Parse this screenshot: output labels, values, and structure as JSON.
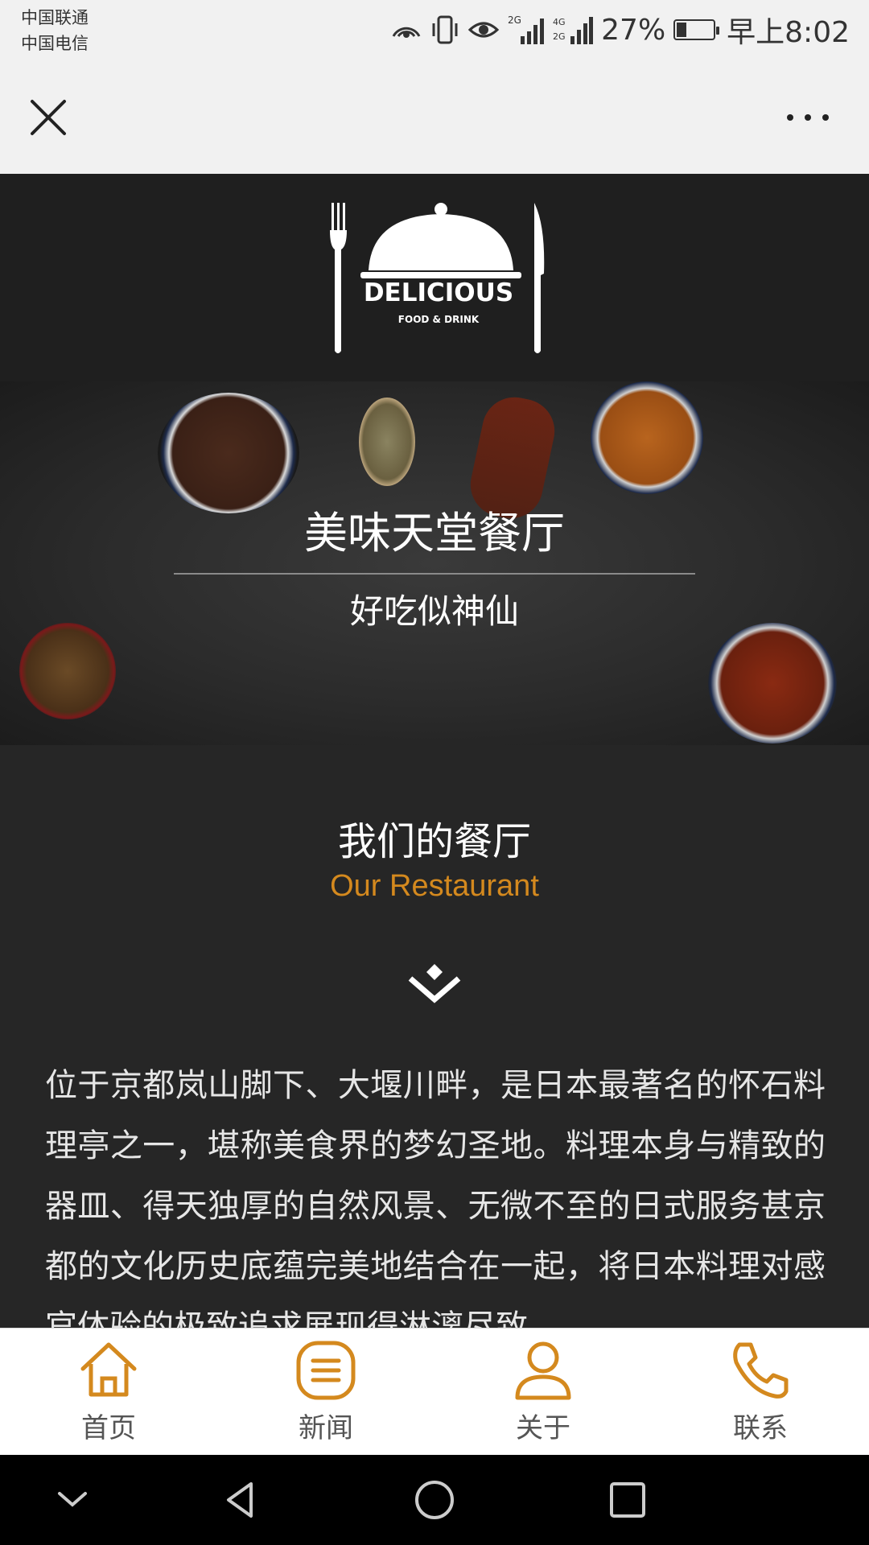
{
  "status_bar": {
    "carrier_1": "中国联通",
    "carrier_2": "中国电信",
    "network_1": "2G",
    "network_2": "4G 2G",
    "battery_percent": "27%",
    "battery_level": 0.27,
    "time": "早上8:02",
    "icons": [
      "hotspot-icon",
      "vibrate-icon",
      "eye-icon",
      "signal-icon",
      "signal-icon",
      "battery-icon"
    ]
  },
  "nav_bar": {
    "close_icon": "close-icon",
    "more_icon": "more-icon"
  },
  "logo": {
    "title": "DELICIOUS",
    "subtitle": "FOOD & DRINK"
  },
  "hero": {
    "title": "美味天堂餐厅",
    "subtitle": "好吃似神仙"
  },
  "section": {
    "title": "我们的餐厅",
    "subtitle": "Our Restaurant",
    "body": "位于京都岚山脚下、大堰川畔，是日本最著名的怀石料理亭之一，堪称美食界的梦幻圣地。料理本身与精致的器皿、得天独厚的自然风景、无微不至的日式服务甚京都的文化历史底蕴完美地结合在一起，将日本料理对感官体验的极致追求展现得淋漓尽致。"
  },
  "tabs": [
    {
      "label": "首页",
      "icon": "home-icon"
    },
    {
      "label": "新闻",
      "icon": "news-icon"
    },
    {
      "label": "关于",
      "icon": "user-icon"
    },
    {
      "label": "联系",
      "icon": "phone-icon"
    }
  ],
  "colors": {
    "accent": "#d4891e",
    "background": "#262626"
  }
}
